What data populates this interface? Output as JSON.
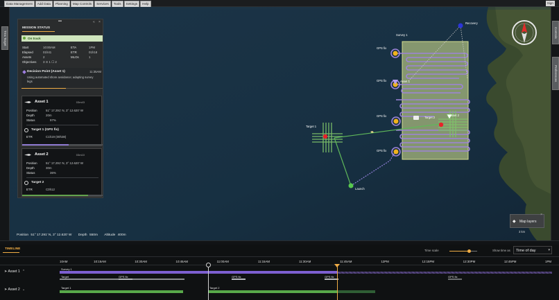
{
  "menu": [
    "Data Management",
    "Add Data",
    "Planning",
    "Map Controls",
    "Services",
    "Tools",
    "Settings",
    "Help"
  ],
  "sign_in": "Sign",
  "left_tab": "Tms Target",
  "right_tabs": [
    "Controls",
    "Preferences"
  ],
  "mission": {
    "title": "MISSION STATUS",
    "status": "On track",
    "fields": [
      {
        "label": "Start",
        "value": "10:00AM"
      },
      {
        "label": "ETA",
        "value": "1PM"
      },
      {
        "label": "Elapsed",
        "value": "01h41"
      },
      {
        "label": "ETR",
        "value": "01h18"
      },
      {
        "label": "Assets",
        "value": "2"
      },
      {
        "label": "MLOs",
        "value": "1"
      },
      {
        "label": "Objectives",
        "value": "3 ⊙ 1 ☐ 2"
      }
    ],
    "decision": {
      "title": "Decision Point (Asset 1)",
      "time": "11:35AM",
      "text": "Using automated shore avoidance; adapting survey legs",
      "progress": 0.55
    }
  },
  "assets": [
    {
      "name": "Asset 1",
      "battery": "03m43",
      "position": "51° 17.291' N, 3° 12.620' W",
      "depth": "20m",
      "status": "97%",
      "target_name": "Target 1 (GPS fix)",
      "etr_label": "ETR",
      "etr": "C1h19 (00h38)",
      "progress": 0.58
    },
    {
      "name": "Asset 2",
      "battery": "03m10",
      "position": "51° 17.291' N, 3° 12.620' W",
      "depth": "30m",
      "status": "36%",
      "target_name": "Target 2",
      "etr_label": "ETR",
      "etr": "C0h12",
      "progress": 0.82
    }
  ],
  "labels": {
    "position": "Position",
    "depth": "Depth",
    "status": "Status",
    "start_time": "Start"
  },
  "coordbar": {
    "position_label": "Position",
    "position": "51° 17.291' N, 3° 12.620' W",
    "depth_label": "Depth",
    "depth": "550m",
    "altitude_label": "Altitude",
    "altitude": "400m"
  },
  "map": {
    "labels": {
      "survey1": "Survey 1",
      "recovery": "Recovery",
      "target1": "Target 1",
      "target2": "Target 2",
      "launch": "Launch",
      "asset1": "Asset 1",
      "asset2": "Asset 2",
      "gps1": "GPS fix",
      "gps2": "GPS fix",
      "gps3": "GPS fix",
      "gps4": "GPS fix"
    },
    "layers_label": "Map layers",
    "scale": "3 km"
  },
  "timeline": {
    "tab": "TIMELINE",
    "time_scale_label": "Time scale",
    "time_scale": 0.7,
    "show_time_label": "Show time as",
    "show_time_value": "Time of day",
    "ticks": [
      "10AM",
      "10:15AM",
      "10:30AM",
      "10:45AM",
      "11:00AM",
      "11:15AM",
      "11:30AM",
      "11:45AM",
      "12PM",
      "12:15PM",
      "12:30PM",
      "12:45PM",
      "1PM"
    ],
    "rows": [
      {
        "label": "Asset 1",
        "bars": [
          "Survey 1",
          "Target",
          "GPS fix",
          "GPS fix",
          "GPS fix",
          "GPS fix"
        ]
      },
      {
        "label": "Asset 2",
        "bars": [
          "Target 1",
          "Target 2"
        ]
      }
    ]
  }
}
